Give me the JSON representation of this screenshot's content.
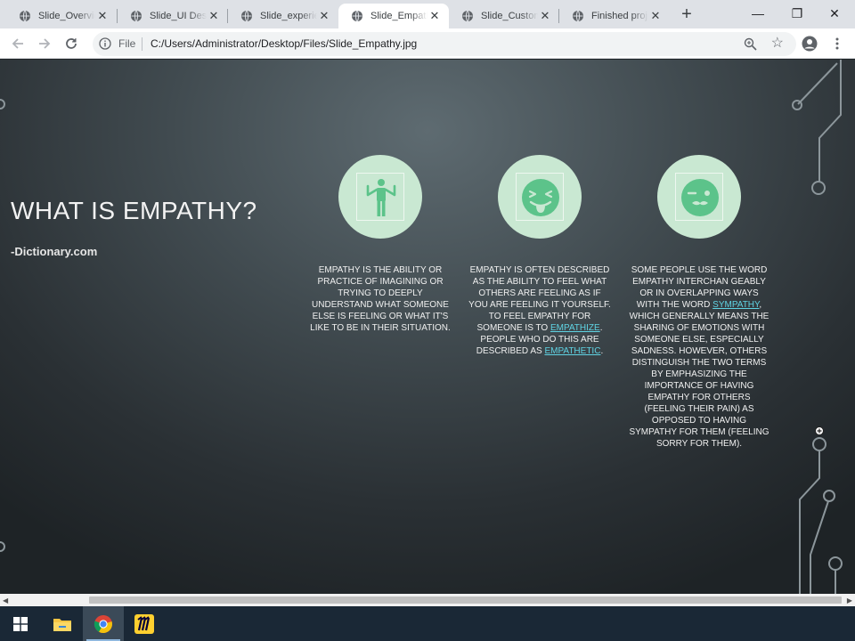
{
  "browser": {
    "tabs": [
      {
        "title": "Slide_Overview",
        "active": false
      },
      {
        "title": "Slide_UI Design",
        "active": false
      },
      {
        "title": "Slide_experience",
        "active": false
      },
      {
        "title": "Slide_Empathy",
        "active": true
      },
      {
        "title": "Slide_Customer",
        "active": false
      },
      {
        "title": "Finished project",
        "active": false
      }
    ],
    "new_tab_label": "+",
    "close_glyph": "✕",
    "window_controls": {
      "minimize": "—",
      "restore": "❐",
      "close": "✕"
    },
    "omnibox": {
      "scheme_label": "File",
      "url": "C:/Users/Administrator/Desktop/Files/Slide_Empathy.jpg"
    }
  },
  "slide": {
    "title": "WHAT IS EMPATHY?",
    "source": "-Dictionary.com",
    "columns": [
      {
        "icon": "person-shrug-icon",
        "segments": [
          {
            "text": "EMPATHY IS THE ABILITY OR PRACTICE OF IMAGINING OR TRYING TO DEEPLY UNDERSTAND WHAT SOMEONE ELSE IS FEELING OR WHAT IT'S LIKE TO BE IN THEIR SITUATION."
          }
        ]
      },
      {
        "icon": "tongue-out-face-icon",
        "segments": [
          {
            "text": "EMPATHY IS OFTEN DESCRIBED AS THE ABILITY TO FEEL WHAT OTHERS ARE FEELING AS IF YOU ARE FEELING IT YOURSELF. TO FEEL EMPATHY FOR SOMEONE IS TO "
          },
          {
            "text": "EMPATHIZE",
            "link": true
          },
          {
            "text": ". PEOPLE WHO DO THIS ARE DESCRIBED AS "
          },
          {
            "text": "EMPATHETIC",
            "link": true
          },
          {
            "text": "."
          }
        ]
      },
      {
        "icon": "winking-mustache-face-icon",
        "segments": [
          {
            "text": "SOME PEOPLE USE THE WORD EMPATHY INTERCHAN GEABLY OR IN OVERLAPPING WAYS WITH THE WORD "
          },
          {
            "text": "SYMPATHY",
            "link": true
          },
          {
            "text": ", WHICH GENERALLY MEANS THE SHARING OF EMOTIONS WITH SOMEONE ELSE, ESPECIALLY SADNESS. HOWEVER, OTHERS DISTINGUISH THE TWO TERMS BY EMPHASIZING THE IMPORTANCE OF HAVING EMPATHY FOR OTHERS (FEELING THEIR PAIN) AS OPPOSED TO HAVING SYMPATHY FOR THEM (FEELING SORRY FOR THEM)."
          }
        ]
      }
    ]
  },
  "taskbar": {
    "items": [
      {
        "name": "windows-start-icon",
        "active": false
      },
      {
        "name": "file-explorer-icon",
        "active": false
      },
      {
        "name": "chrome-icon",
        "active": true
      },
      {
        "name": "miro-icon",
        "active": false
      }
    ]
  },
  "colors": {
    "accent_green": "#c9e8d2",
    "icon_green": "#5cc38a",
    "link_cyan": "#5fd3e3",
    "slide_bg": "#3c464b",
    "taskbar": "#1a2836"
  }
}
